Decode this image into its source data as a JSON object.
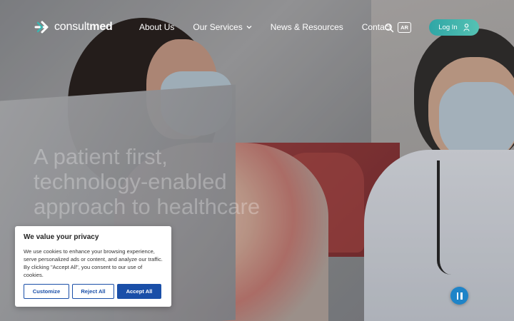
{
  "header": {
    "logo": {
      "text_light": "consult",
      "text_bold": "med"
    },
    "nav": [
      {
        "label": "About Us"
      },
      {
        "label": "Our Services"
      },
      {
        "label": "News & Resources"
      },
      {
        "label": "Contact"
      }
    ],
    "lang_label": "AR",
    "login_label": "Log In"
  },
  "hero": {
    "headline_lines": [
      "A patient first,",
      "technology-enabled",
      "approach to healthcare"
    ]
  },
  "cookie": {
    "title": "We value your privacy",
    "text": "We use cookies to enhance your browsing experience, serve personalized ads or content, and analyze our traffic. By clicking \"Accept All\", you consent to our use of cookies.",
    "buttons": {
      "customize": "Customize",
      "reject": "Reject All",
      "accept": "Accept All"
    }
  },
  "icons": {
    "logo": "arrow-logo-icon",
    "chevron": "chevron-down-icon",
    "search": "search-icon",
    "user": "user-icon",
    "pause": "pause-icon"
  },
  "colors": {
    "accent": "#2fa6a6",
    "cookie_button": "#1a4fa8",
    "pause": "#1f84c8"
  }
}
